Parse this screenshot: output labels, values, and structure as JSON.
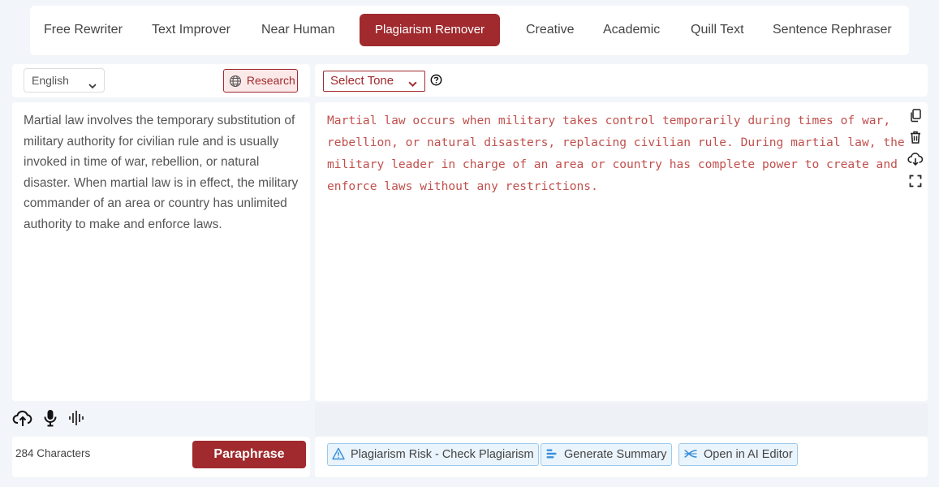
{
  "tabs": [
    {
      "label": "Free Rewriter"
    },
    {
      "label": "Text Improver"
    },
    {
      "label": "Near Human"
    },
    {
      "label": "Plagiarism Remover",
      "active": true
    },
    {
      "label": "Creative"
    },
    {
      "label": "Academic"
    },
    {
      "label": "Quill Text"
    },
    {
      "label": "Sentence Rephraser"
    }
  ],
  "input_panel": {
    "language": "English",
    "research_label": "Research",
    "text": "Martial law involves the temporary substitution of military authority for civilian rule and is usually invoked in time of war, rebellion, or natural disaster. When martial law is in effect, the military commander of an area or country has unlimited authority to make and enforce laws.",
    "char_count": "284 Characters",
    "paraphrase_label": "Paraphrase",
    "tool_icons": [
      "upload-cloud-icon",
      "microphone-icon",
      "audio-wave-icon"
    ]
  },
  "output_panel": {
    "tone_label": "Select Tone",
    "text": "Martial law occurs when military takes control temporarily during times of war, rebellion, or natural disasters, replacing civilian rule. During martial law, the military leader in charge of an area or country has complete power to create and enforce laws without any restrictions.",
    "side_icons": [
      "copy-icon",
      "trash-icon",
      "download-cloud-icon",
      "fullscreen-icon"
    ],
    "actions": [
      {
        "label": "Plagiarism Risk - Check Plagiarism",
        "icon": "warning-icon"
      },
      {
        "label": "Generate Summary",
        "icon": "summary-icon"
      },
      {
        "label": "Open in AI Editor",
        "icon": "editor-icon"
      }
    ]
  },
  "colors": {
    "accent": "#a02a2e",
    "output_text": "#c0504d",
    "action_border": "#9fc9ea",
    "action_bg": "#eaf4fd",
    "icon_blue": "#3a8fd8"
  }
}
